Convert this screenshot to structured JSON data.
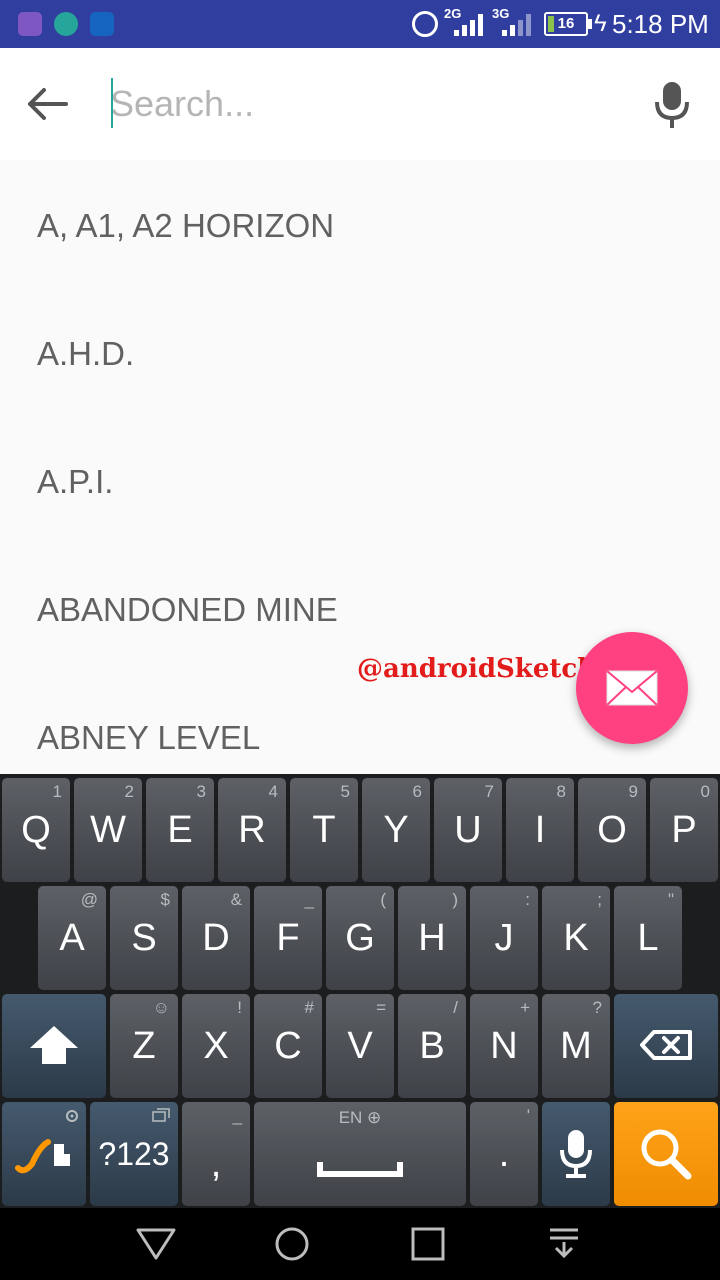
{
  "status_bar": {
    "network_a": "2G",
    "network_b": "3G",
    "battery_level": "16",
    "battery_fraction": 0.16,
    "time": "5:18 PM"
  },
  "search": {
    "placeholder": "Search...",
    "value": ""
  },
  "suggestions": [
    "A, A1, A2 HORIZON",
    "A.H.D.",
    "A.P.I.",
    "ABANDONED MINE",
    "ABNEY LEVEL"
  ],
  "watermark": "@androidSketchPad",
  "colors": {
    "status_bar": "#303f9f",
    "fab": "#ff4081",
    "search_key": "#f59b00",
    "cursor": "#26a69a"
  },
  "keyboard": {
    "row1": [
      {
        "label": "Q",
        "hint": "1"
      },
      {
        "label": "W",
        "hint": "2"
      },
      {
        "label": "E",
        "hint": "3"
      },
      {
        "label": "R",
        "hint": "4"
      },
      {
        "label": "T",
        "hint": "5"
      },
      {
        "label": "Y",
        "hint": "6"
      },
      {
        "label": "U",
        "hint": "7"
      },
      {
        "label": "I",
        "hint": "8"
      },
      {
        "label": "O",
        "hint": "9"
      },
      {
        "label": "P",
        "hint": "0"
      }
    ],
    "row2": [
      {
        "label": "A",
        "hint": "@"
      },
      {
        "label": "S",
        "hint": "$"
      },
      {
        "label": "D",
        "hint": "&"
      },
      {
        "label": "F",
        "hint": "_"
      },
      {
        "label": "G",
        "hint": "("
      },
      {
        "label": "H",
        "hint": ")"
      },
      {
        "label": "J",
        "hint": ":"
      },
      {
        "label": "K",
        "hint": ";"
      },
      {
        "label": "L",
        "hint": "\""
      }
    ],
    "row3": [
      {
        "label": "Z",
        "hint": "☺"
      },
      {
        "label": "X",
        "hint": "!"
      },
      {
        "label": "C",
        "hint": "#"
      },
      {
        "label": "V",
        "hint": "="
      },
      {
        "label": "B",
        "hint": "/"
      },
      {
        "label": "N",
        "hint": "+"
      },
      {
        "label": "M",
        "hint": "?"
      }
    ],
    "symbols_label": "?123",
    "comma_label": ",",
    "comma_hint": "_",
    "language_label": "EN",
    "period_label": ".",
    "period_hint": "'",
    "icons": {
      "swype": "swype-icon",
      "settings": "gear-icon",
      "shift": "shift-icon",
      "delete": "backspace-icon",
      "mic": "microphone-icon",
      "search": "search-icon"
    }
  },
  "nav_icons": [
    "back-triangle-icon",
    "home-circle-icon",
    "recents-square-icon",
    "notification-pulldown-icon"
  ]
}
